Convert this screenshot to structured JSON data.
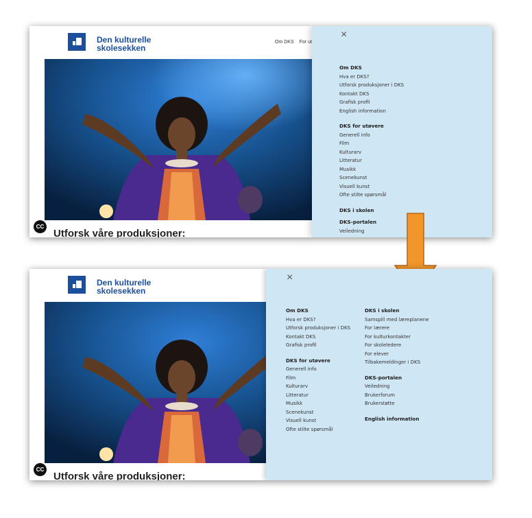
{
  "logo": {
    "line1": "Den kulturelle",
    "line2": "skolesekken"
  },
  "top_nav": [
    "Om DKS",
    "For ut"
  ],
  "close_icon": "×",
  "page_heading": "Utforsk våre produksjoner:",
  "cc_badge": "CC",
  "before_menu": [
    {
      "heading": "Om DKS",
      "items": [
        "Hva er DKS?",
        "Utforsk produksjoner i DKS",
        "Kontakt DKS",
        "Grafisk profil",
        "English information"
      ]
    },
    {
      "heading": "DKS for utøvere",
      "items": [
        "Generell info",
        "Film",
        "Kulturarv",
        "Litteratur",
        "Musikk",
        "Scenekunst",
        "Visuell kunst",
        "Ofte stilte spørsmål"
      ]
    },
    {
      "heading": "DKS i skolen",
      "items": []
    },
    {
      "heading": "DKS-portalen",
      "items": [
        "Veiledning"
      ]
    }
  ],
  "after_menu": {
    "left": [
      {
        "heading": "Om DKS",
        "items": [
          "Hva er DKS?",
          "Utforsk produksjoner i DKS",
          "Kontakt DKS",
          "Grafisk profil"
        ]
      },
      {
        "heading": "DKS for utøvere",
        "items": [
          "Generell info",
          "Film",
          "Kulturarv",
          "Litteratur",
          "Musikk",
          "Scenekunst",
          "Visuell kunst",
          "Ofte stilte spørsmål"
        ]
      }
    ],
    "right": [
      {
        "heading": "DKS i skolen",
        "items": [
          "Samspill med læreplanene",
          "For lærere",
          "For kulturkontakter",
          "For skoleledere",
          "For elever",
          "Tilbakemeldinger i DKS"
        ]
      },
      {
        "heading": "DKS-portalen",
        "items": [
          "Veiledning",
          "Brukerforum",
          "Brukerstøtte"
        ]
      },
      {
        "heading": "English information",
        "items": []
      }
    ]
  },
  "colors": {
    "brand_blue": "#1b4f9c",
    "panel_bg": "#cfe6f4",
    "arrow_fill": "#f0962a",
    "arrow_stroke": "#b8651a"
  }
}
